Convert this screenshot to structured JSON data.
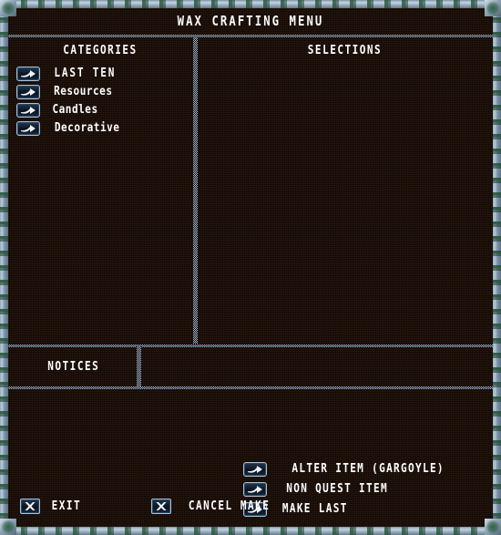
{
  "window": {
    "title": "WAX CRAFTING MENU"
  },
  "colors": {
    "frame_light": "#b9cbd9",
    "frame_dark": "#5f7489",
    "frame_vine": "#22523a",
    "screen_bg": "#0c0705",
    "divider": "#a9c2dd",
    "text": "#ffffff",
    "icon_border": "#a9c2dd",
    "icon_fill": "#16283a"
  },
  "columns": {
    "categories_header": "CATEGORIES",
    "selections_header": "SELECTIONS"
  },
  "categories": {
    "items": [
      {
        "label": "LAST TEN",
        "icon": "arrow-right-icon",
        "spaced": true
      },
      {
        "label": "Resources",
        "icon": "arrow-right-icon",
        "spaced": false
      },
      {
        "label": "Candles",
        "icon": "arrow-right-icon",
        "spaced": false
      },
      {
        "label": "Decorative",
        "icon": "arrow-right-icon",
        "spaced": false
      }
    ]
  },
  "selections": {
    "items": []
  },
  "notices": {
    "tab_label": "NOTICES",
    "message": ""
  },
  "actions": {
    "right": [
      {
        "label": "ALTER ITEM (GARGOYLE)",
        "icon": "arrow-right-icon"
      },
      {
        "label": "NON QUEST ITEM",
        "icon": "arrow-right-icon"
      },
      {
        "label": "MAKE LAST",
        "icon": "arrow-right-icon"
      }
    ],
    "exit_label": "EXIT",
    "cancel_label": "CANCEL MAKE",
    "exit_icon": "close-x-icon",
    "cancel_icon": "close-x-icon"
  }
}
